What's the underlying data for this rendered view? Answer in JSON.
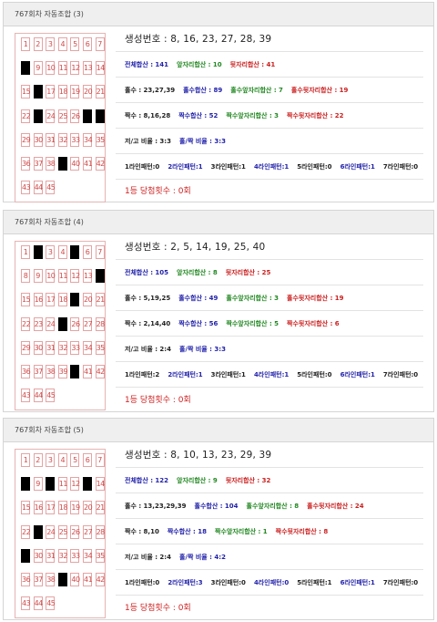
{
  "panels": [
    {
      "title": "767회차 자동조합 (3)",
      "marked": [
        8,
        16,
        23,
        27,
        28,
        39
      ],
      "gen": "생성번호 : 8, 16, 23, 27, 28, 39",
      "r1": {
        "a": "전체합산 : 141",
        "b": "앞자리합산 : 10",
        "c": "뒷자리합산 : 41"
      },
      "r2": {
        "a": "홀수 : 23,27,39",
        "b": "홀수합산 : 89",
        "c": "홀수앞자리합산 : 7",
        "d": "홀수뒷자리합산 : 19"
      },
      "r3": {
        "a": "짝수 : 8,16,28",
        "b": "짝수합산 : 52",
        "c": "짝수앞자리합산 : 3",
        "d": "짝수뒷자리합산 : 22"
      },
      "r4": {
        "a": "저/고 비율 : 3:3",
        "b": "홀/짝 비율 : 3:3"
      },
      "r5": [
        "1라인패턴:0",
        "2라인패턴:1",
        "3라인패턴:1",
        "4라인패턴:1",
        "5라인패턴:0",
        "6라인패턴:1",
        "7라인패턴:0"
      ],
      "win": "1등 당첨횟수 : 0회"
    },
    {
      "title": "767회차 자동조합 (4)",
      "marked": [
        2,
        5,
        14,
        19,
        25,
        40
      ],
      "gen": "생성번호 : 2, 5, 14, 19, 25, 40",
      "r1": {
        "a": "전체합산 : 105",
        "b": "앞자리합산 : 8",
        "c": "뒷자리합산 : 25"
      },
      "r2": {
        "a": "홀수 : 5,19,25",
        "b": "홀수합산 : 49",
        "c": "홀수앞자리합산 : 3",
        "d": "홀수뒷자리합산 : 19"
      },
      "r3": {
        "a": "짝수 : 2,14,40",
        "b": "짝수합산 : 56",
        "c": "짝수앞자리합산 : 5",
        "d": "짝수뒷자리합산 : 6"
      },
      "r4": {
        "a": "저/고 비율 : 2:4",
        "b": "홀/짝 비율 : 3:3"
      },
      "r5": [
        "1라인패턴:2",
        "2라인패턴:1",
        "3라인패턴:1",
        "4라인패턴:1",
        "5라인패턴:0",
        "6라인패턴:1",
        "7라인패턴:0"
      ],
      "win": "1등 당첨횟수 : 0회"
    },
    {
      "title": "767회차 자동조합 (5)",
      "marked": [
        8,
        10,
        13,
        23,
        29,
        39
      ],
      "gen": "생성번호 : 8, 10, 13, 23, 29, 39",
      "r1": {
        "a": "전체합산 : 122",
        "b": "앞자리합산 : 9",
        "c": "뒷자리합산 : 32"
      },
      "r2": {
        "a": "홀수 : 13,23,29,39",
        "b": "홀수합산 : 104",
        "c": "홀수앞자리합산 : 8",
        "d": "홀수뒷자리합산 : 24"
      },
      "r3": {
        "a": "짝수 : 8,10",
        "b": "짝수합산 : 18",
        "c": "짝수앞자리합산 : 1",
        "d": "짝수뒷자리합산 : 8"
      },
      "r4": {
        "a": "저/고 비율 : 2:4",
        "b": "홀/짝 비율 : 4:2"
      },
      "r5": [
        "1라인패턴:0",
        "2라인패턴:3",
        "3라인패턴:0",
        "4라인패턴:0",
        "5라인패턴:1",
        "6라인패턴:1",
        "7라인패턴:0"
      ],
      "win": "1등 당첨횟수 : 0회"
    }
  ]
}
